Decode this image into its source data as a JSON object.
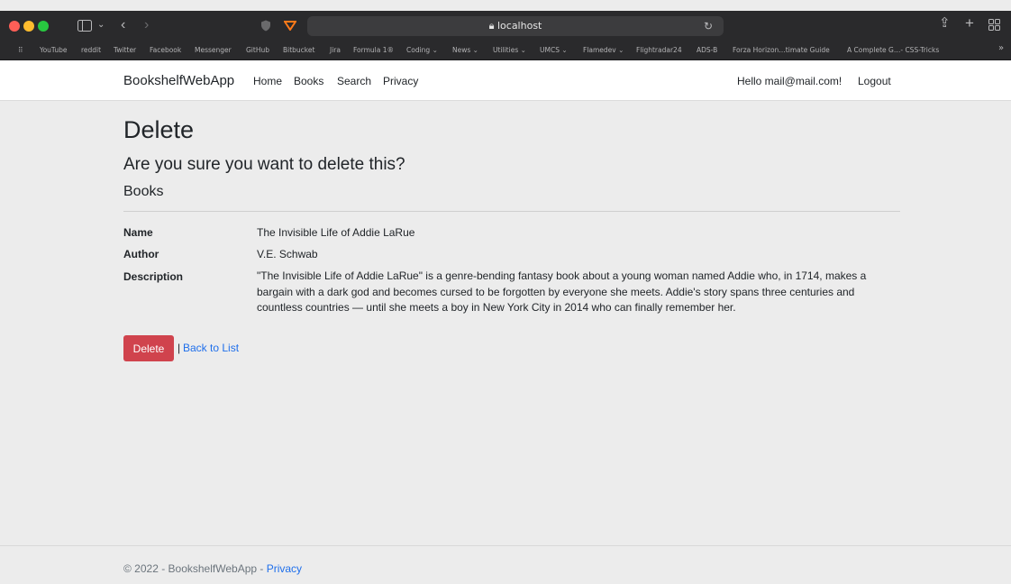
{
  "browser": {
    "url": "localhost",
    "bookmarks": [
      "YouTube",
      "reddit",
      "Twitter",
      "Facebook",
      "Messenger",
      "GitHub",
      "Bitbucket",
      "Jira",
      "Formula 1®",
      "Coding ⌄",
      "News ⌄",
      "Utilities ⌄",
      "UMCS ⌄",
      "Flamedev ⌄",
      "Flightradar24",
      "ADS-B",
      "Forza Horizon…timate Guide",
      "A Complete G…- CSS-Tricks"
    ]
  },
  "nav": {
    "brand": "BookshelfWebApp",
    "links": [
      "Home",
      "Books",
      "Search",
      "Privacy"
    ],
    "greeting": "Hello mail@mail.com!",
    "logout": "Logout"
  },
  "content": {
    "title": "Delete",
    "question": "Are you sure you want to delete this?",
    "entity": "Books",
    "fields": [
      {
        "label": "Name",
        "value": "The Invisible Life of Addie LaRue"
      },
      {
        "label": "Author",
        "value": "V.E. Schwab"
      },
      {
        "label": "Description",
        "value": "\"The Invisible Life of Addie LaRue\" is a genre-bending fantasy book about a young woman named Addie who, in 1714, makes a bargain with a dark god and becomes cursed to be forgotten by everyone she meets. Addie's story spans three centuries and countless countries — until she meets a boy in New York City in 2014 who can finally remember her."
      }
    ],
    "delete_label": "Delete",
    "separator": "|",
    "back_label": "Back to List"
  },
  "footer": {
    "text": "© 2022 - BookshelfWebApp - ",
    "privacy": "Privacy"
  },
  "colors": {
    "delete_button": "#d0434d",
    "link": "#1f6feb",
    "titlebar": "#2a2a2c"
  }
}
